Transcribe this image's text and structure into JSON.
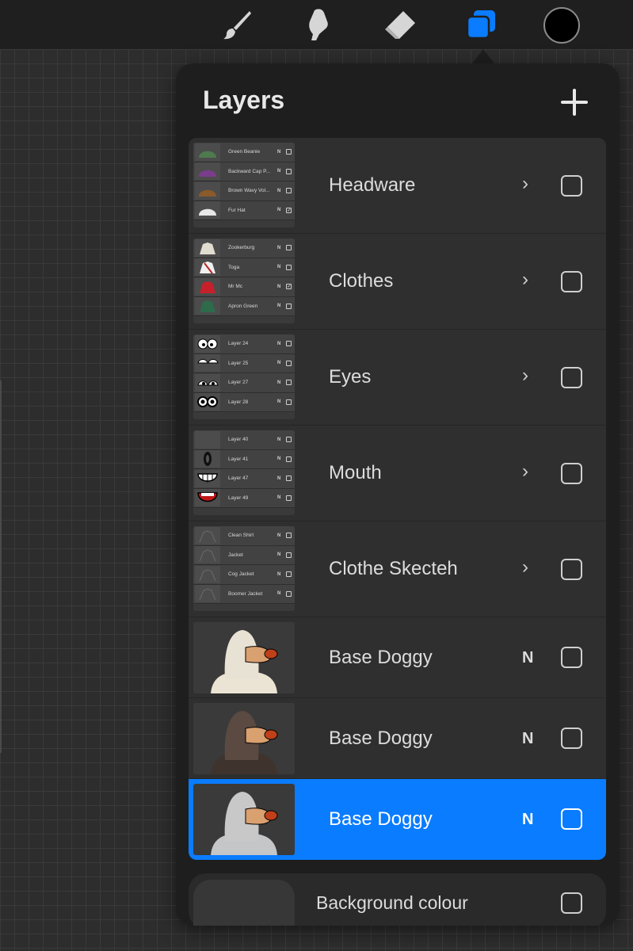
{
  "toolbar": {
    "tools": [
      "brush-icon",
      "smudge-icon",
      "eraser-icon",
      "layers-icon"
    ],
    "active_tool": "layers-icon",
    "current_color": "#000000",
    "accent_color": "#0a7cff"
  },
  "panel": {
    "title": "Layers",
    "add_icon": "plus-icon"
  },
  "layers": [
    {
      "name": "Headware",
      "type": "group",
      "visible": false,
      "children": [
        {
          "name": "Green Beanie",
          "mode": "N",
          "checked": false,
          "color": "#4e7a4e"
        },
        {
          "name": "Backward Cap P...",
          "mode": "N",
          "checked": false,
          "color": "#7a3d8c"
        },
        {
          "name": "Brown Wavy Vol...",
          "mode": "N",
          "checked": false,
          "color": "#8a5a2b"
        },
        {
          "name": "Fur Hat",
          "mode": "N",
          "checked": true,
          "color": "#e8e8e8"
        }
      ]
    },
    {
      "name": "Clothes",
      "type": "group",
      "visible": false,
      "children": [
        {
          "name": "Zookerburg",
          "mode": "N",
          "checked": false,
          "color": "#e0ddd0"
        },
        {
          "name": "Toga",
          "mode": "N",
          "checked": false,
          "color": "#f0f0f0"
        },
        {
          "name": "Mr Mc",
          "mode": "N",
          "checked": true,
          "color": "#c8202a"
        },
        {
          "name": "Apron Green",
          "mode": "N",
          "checked": false,
          "color": "#2e6b4a"
        }
      ]
    },
    {
      "name": "Eyes",
      "type": "group",
      "visible": false,
      "children": [
        {
          "name": "Layer 24",
          "mode": "N",
          "checked": false,
          "color": "#ffffff"
        },
        {
          "name": "Layer 25",
          "mode": "N",
          "checked": false,
          "color": "#ffffff"
        },
        {
          "name": "Layer 27",
          "mode": "N",
          "checked": false,
          "color": "#ffffff"
        },
        {
          "name": "Layer 28",
          "mode": "N",
          "checked": false,
          "color": "#ffffff"
        }
      ]
    },
    {
      "name": "Mouth",
      "type": "group",
      "visible": false,
      "children": [
        {
          "name": "Layer 40",
          "mode": "N",
          "checked": false,
          "color": "#4c4c4c"
        },
        {
          "name": "Layer 41",
          "mode": "N",
          "checked": false,
          "color": "#111111"
        },
        {
          "name": "Layer 47",
          "mode": "N",
          "checked": false,
          "color": "#ffffff"
        },
        {
          "name": "Layer 49",
          "mode": "N",
          "checked": false,
          "color": "#c01818"
        }
      ]
    },
    {
      "name": "Clothe Skecteh",
      "type": "group",
      "visible": false,
      "children": [
        {
          "name": "Clean Shirt",
          "mode": "N",
          "checked": false,
          "color": "#5a5a5a"
        },
        {
          "name": "Jacket",
          "mode": "N",
          "checked": false,
          "color": "#5a5a5a"
        },
        {
          "name": "Cog Jacket",
          "mode": "N",
          "checked": false,
          "color": "#5a5a5a"
        },
        {
          "name": "Boomer Jacket",
          "mode": "N",
          "checked": false,
          "color": "#5a5a5a"
        }
      ]
    },
    {
      "name": "Base Doggy",
      "type": "layer",
      "mode": "N",
      "visible": false,
      "selected": false,
      "head_color": "#e8e2d4",
      "body_color": "#ebe4d4"
    },
    {
      "name": "Base Doggy",
      "type": "layer",
      "mode": "N",
      "visible": false,
      "selected": false,
      "head_color": "#5a4a42",
      "body_color": "#3e332d"
    },
    {
      "name": "Base Doggy",
      "type": "layer",
      "mode": "N",
      "visible": false,
      "selected": true,
      "head_color": "#c8c8c8",
      "body_color": "#c4c6c8"
    }
  ],
  "background": {
    "name": "Background colour",
    "visible": false,
    "swatch_color": "#373737"
  }
}
